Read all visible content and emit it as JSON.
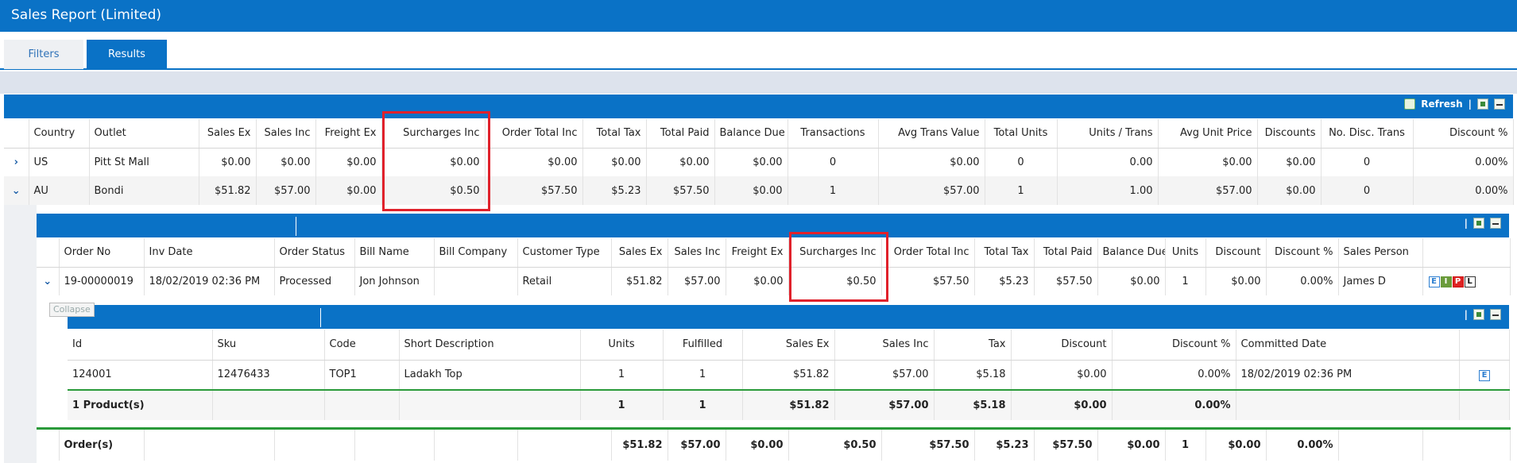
{
  "app": {
    "title": "Sales Report (Limited)"
  },
  "tabs": {
    "filters": "Filters",
    "results": "Results"
  },
  "toolbar": {
    "refresh": "Refresh",
    "separator": "|"
  },
  "outer_headers": [
    "Country",
    "Outlet",
    "Sales Ex",
    "Sales Inc",
    "Freight Ex",
    "Surcharges Inc",
    "Order Total Inc",
    "Total Tax",
    "Total Paid",
    "Balance Due",
    "Transactions",
    "Avg Trans Value",
    "Total Units",
    "Units / Trans",
    "Avg Unit Price",
    "Discounts",
    "No. Disc. Trans",
    "Discount %"
  ],
  "outer_rows": [
    {
      "expander": "›",
      "cells": [
        "US",
        "Pitt St Mall",
        "$0.00",
        "$0.00",
        "$0.00",
        "$0.00",
        "$0.00",
        "$0.00",
        "$0.00",
        "$0.00",
        "0",
        "$0.00",
        "0",
        "0.00",
        "$0.00",
        "$0.00",
        "0",
        "0.00%"
      ]
    },
    {
      "expander": "⌄",
      "cells": [
        "AU",
        "Bondi",
        "$51.82",
        "$57.00",
        "$0.00",
        "$0.50",
        "$57.50",
        "$5.23",
        "$57.50",
        "$0.00",
        "1",
        "$57.00",
        "1",
        "1.00",
        "$57.00",
        "$0.00",
        "0",
        "0.00%"
      ]
    }
  ],
  "inner_headers": [
    "Order No",
    "Inv Date",
    "Order Status",
    "Bill Name",
    "Bill Company",
    "Customer Type",
    "Sales Ex",
    "Sales Inc",
    "Freight Ex",
    "Surcharges Inc",
    "Order Total Inc",
    "Total Tax",
    "Total Paid",
    "Balance Due",
    "Units",
    "Discount",
    "Discount %",
    "Sales Person"
  ],
  "inner_row": {
    "expander": "⌄",
    "cells": [
      "19-00000019",
      "18/02/2019 02:36 PM",
      "Processed",
      "Jon Johnson",
      "",
      "Retail",
      "$51.82",
      "$57.00",
      "$0.00",
      "$0.50",
      "$57.50",
      "$5.23",
      "$57.50",
      "$0.00",
      "1",
      "$0.00",
      "0.00%",
      "James D"
    ],
    "actions": [
      "E",
      "I",
      "P",
      "L"
    ]
  },
  "collapse_tooltip": "Collapse",
  "item_headers": [
    "Id",
    "Sku",
    "Code",
    "Short Description",
    "Units",
    "Fulfilled",
    "Sales Ex",
    "Sales Inc",
    "Tax",
    "Discount",
    "Discount %",
    "Committed Date"
  ],
  "item_row": {
    "cells": [
      "124001",
      "12476433",
      "TOP1",
      "Ladakh Top",
      "1",
      "1",
      "$51.82",
      "$57.00",
      "$5.18",
      "$0.00",
      "0.00%",
      "18/02/2019 02:36 PM"
    ],
    "action": "E"
  },
  "item_summary": [
    "1 Product(s)",
    "",
    "",
    "",
    "1",
    "1",
    "$51.82",
    "$57.00",
    "$5.18",
    "$0.00",
    "0.00%",
    ""
  ],
  "orders_summary": [
    "Order(s)",
    "",
    "",
    "",
    "",
    "",
    "$51.82",
    "$57.00",
    "$0.00",
    "$0.50",
    "$57.50",
    "$5.23",
    "$57.50",
    "$0.00",
    "1",
    "$0.00",
    "0.00%",
    ""
  ],
  "colors": {
    "brand": "#0a72c6",
    "highlight": "#e0212b",
    "summary_rule": "#2a9a3a"
  }
}
